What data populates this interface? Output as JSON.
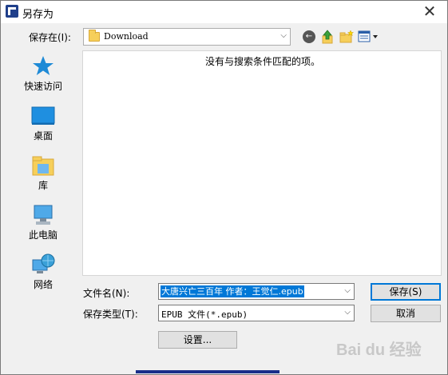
{
  "window": {
    "title": "另存为",
    "close_glyph": "✕"
  },
  "location": {
    "label": "保存在(I):",
    "value": "Download"
  },
  "places": [
    {
      "label": "快速访问",
      "icon": "star-icon"
    },
    {
      "label": "桌面",
      "icon": "desktop-icon"
    },
    {
      "label": "库",
      "icon": "library-icon"
    },
    {
      "label": "此电脑",
      "icon": "computer-icon"
    },
    {
      "label": "网络",
      "icon": "network-icon"
    }
  ],
  "filelist": {
    "empty_message": "没有与搜索条件匹配的项。"
  },
  "form": {
    "filename_label": "文件名(N):",
    "filename_value": "大唐兴亡三百年 作者：王觉仁.epub",
    "filetype_label": "保存类型(T):",
    "filetype_value": "EPUB 文件(*.epub)",
    "save_label": "保存(S)",
    "cancel_label": "取消",
    "settings_label": "设置..."
  },
  "watermark": "Bai du 经验",
  "colors": {
    "accent": "#0078d7",
    "dialog_bg": "#f0f0f0"
  }
}
